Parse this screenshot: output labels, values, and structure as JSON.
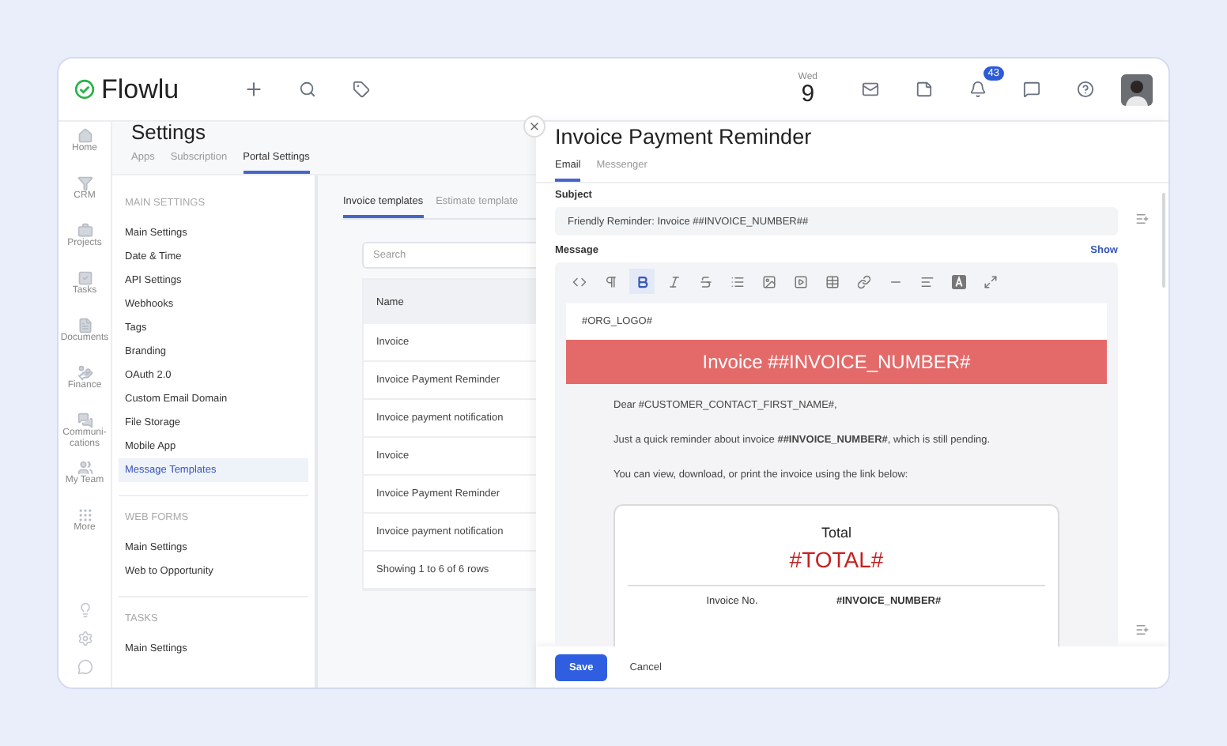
{
  "topbar": {
    "logo": "Flowlu",
    "date": {
      "weekday": "Wed",
      "day": "9"
    },
    "notifications_badge": "43"
  },
  "rail": [
    {
      "kind": "home",
      "label": "Home"
    },
    {
      "kind": "crm",
      "label": "CRM"
    },
    {
      "kind": "projects",
      "label": "Projects"
    },
    {
      "kind": "tasks",
      "label": "Tasks"
    },
    {
      "kind": "documents",
      "label": "Documents"
    },
    {
      "kind": "finance",
      "label": "Finance"
    },
    {
      "kind": "communications",
      "label": "Communi-cations"
    },
    {
      "kind": "team",
      "label": "My Team"
    },
    {
      "kind": "more",
      "label": "More"
    }
  ],
  "settings": {
    "title": "Settings",
    "tabs": [
      {
        "label": "Apps",
        "selected": false
      },
      {
        "label": "Subscription",
        "selected": false
      },
      {
        "label": "Portal Settings",
        "selected": true
      }
    ],
    "nav": [
      {
        "heading": "MAIN SETTINGS",
        "items": [
          {
            "label": "Main Settings",
            "selected": false
          },
          {
            "label": "Date & Time",
            "selected": false
          },
          {
            "label": "API Settings",
            "selected": false
          },
          {
            "label": "Webhooks",
            "selected": false
          },
          {
            "label": "Tags",
            "selected": false
          },
          {
            "label": "Branding",
            "selected": false
          },
          {
            "label": "OAuth 2.0",
            "selected": false
          },
          {
            "label": "Custom Email Domain",
            "selected": false
          },
          {
            "label": "File Storage",
            "selected": false
          },
          {
            "label": "Mobile App",
            "selected": false
          },
          {
            "label": "Message Templates",
            "selected": true
          }
        ]
      },
      {
        "heading": "WEB FORMS",
        "items": [
          {
            "label": "Main Settings",
            "selected": false
          },
          {
            "label": "Web to Opportunity",
            "selected": false
          }
        ]
      },
      {
        "heading": "TASKS",
        "items": [
          {
            "label": "Main Settings",
            "selected": false
          }
        ]
      }
    ],
    "content_tabs": [
      {
        "label": "Invoice templates",
        "selected": true
      },
      {
        "label": "Estimate template",
        "selected": false
      }
    ],
    "search": {
      "placeholder": "Search"
    },
    "table": {
      "columns": [
        "Name"
      ],
      "rows": [
        "Invoice",
        "Invoice Payment Reminder",
        "Invoice payment notification",
        "Invoice",
        "Invoice Payment Reminder",
        "Invoice payment notification"
      ],
      "footer": "Showing 1 to 6 of 6 rows"
    }
  },
  "drawer": {
    "title": "Invoice Payment Reminder",
    "tabs": [
      {
        "label": "Email",
        "selected": true
      },
      {
        "label": "Messenger",
        "selected": false
      }
    ],
    "subject": {
      "label": "Subject",
      "value": "Friendly Reminder: Invoice ##INVOICE_NUMBER##"
    },
    "message": {
      "label": "Message",
      "link": "Show",
      "toolbar": [
        {
          "kind": "code",
          "selected": false
        },
        {
          "kind": "paragraph",
          "selected": false
        },
        {
          "kind": "bold",
          "selected": true
        },
        {
          "kind": "italic",
          "selected": false
        },
        {
          "kind": "strike",
          "selected": false
        },
        {
          "kind": "list",
          "selected": false
        },
        {
          "kind": "image",
          "selected": false
        },
        {
          "kind": "video",
          "selected": false
        },
        {
          "kind": "table",
          "selected": false
        },
        {
          "kind": "link",
          "selected": false
        },
        {
          "kind": "rule",
          "selected": false
        },
        {
          "kind": "align",
          "selected": false
        },
        {
          "kind": "color",
          "selected": false
        },
        {
          "kind": "fullscreen",
          "selected": false
        }
      ],
      "logo_placeholder": "#ORG_LOGO#",
      "banner": "Invoice ##INVOICE_NUMBER#",
      "paragraphs": [
        "Dear #CUSTOMER_CONTACT_FIRST_NAME#,",
        "Just a quick reminder about invoice **##INVOICE_NUMBER#**, which is still pending.",
        "You can view, download, or print the invoice using the link below:"
      ],
      "card": {
        "label": "Total",
        "amount": "#TOTAL#",
        "rows": [
          {
            "label": "Invoice No.",
            "value": "#INVOICE_NUMBER#"
          }
        ]
      }
    },
    "buttons": {
      "save": "Save",
      "cancel": "Cancel"
    }
  }
}
